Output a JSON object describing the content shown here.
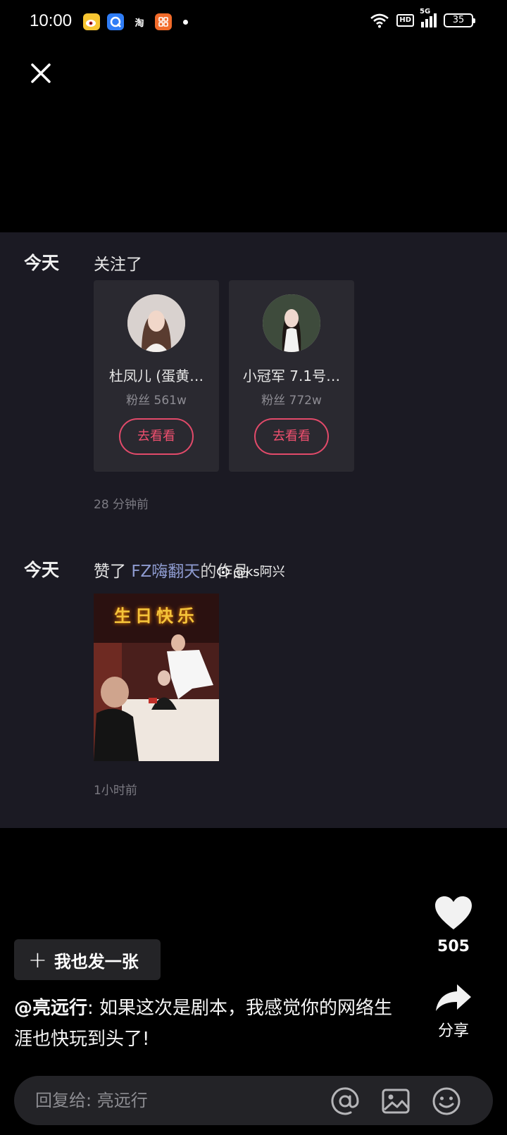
{
  "status_bar": {
    "time": "10:00",
    "app_icons": [
      {
        "name": "weibo-icon",
        "glyph": "微",
        "color": "#f5a623"
      },
      {
        "name": "browser-icon",
        "glyph": "Q",
        "color": "#3b8cf0"
      },
      {
        "name": "taobao-icon",
        "glyph": "淘",
        "color": "#000000"
      },
      {
        "name": "app-icon",
        "glyph": "品",
        "color": "#f26b2a"
      }
    ],
    "network": "5G",
    "hd": "HD",
    "battery": "35"
  },
  "screenshot": {
    "follow_row": {
      "date": "今天",
      "action": "关注了",
      "cards": [
        {
          "nickname": "杜凤儿 (蛋黄…",
          "fans": "粉丝 561w",
          "button": "去看看"
        },
        {
          "nickname": "小冠军 7.1号…",
          "fans": "粉丝 772w",
          "button": "去看看"
        }
      ],
      "time_ago": "28 分钟前"
    },
    "like_row": {
      "date": "今天",
      "action": "赞了",
      "target": "FZ嗨翻天",
      "suffix": "的作品",
      "thumbnail_text": "生日快乐",
      "time_ago": "1小时前"
    },
    "watermark": "@ks阿兴"
  },
  "actions": {
    "like_count": "505",
    "share_label": "分享"
  },
  "post_button": {
    "label": "我也发一张"
  },
  "comment": {
    "author": "@亮远行",
    "text": ": 如果这次是剧本，我感觉你的网络生涯也快玩到头了!"
  },
  "reply": {
    "placeholder": "回复给: 亮远行"
  }
}
